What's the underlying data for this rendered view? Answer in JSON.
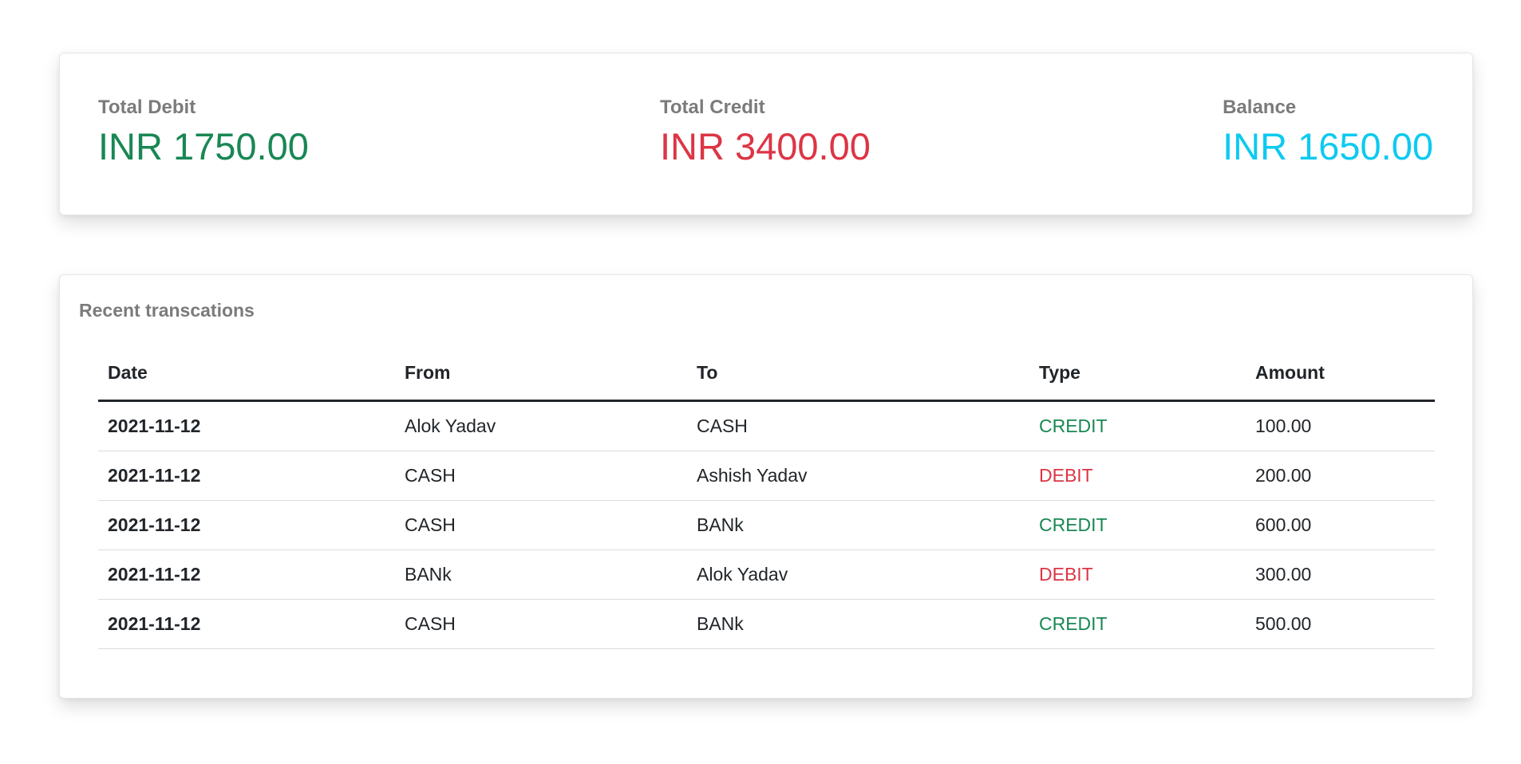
{
  "summary": {
    "total_debit": {
      "label": "Total Debit",
      "value": "INR 1750.00",
      "color": "#198754"
    },
    "total_credit": {
      "label": "Total Credit",
      "value": "INR 3400.00",
      "color": "#dc3545"
    },
    "balance": {
      "label": "Balance",
      "value": "INR 1650.00",
      "color": "#0dcaf0"
    }
  },
  "transactions": {
    "title": "Recent transcations",
    "columns": [
      "Date",
      "From",
      "To",
      "Type",
      "Amount"
    ],
    "rows": [
      {
        "date": "2021-11-12",
        "from": "Alok Yadav",
        "to": "CASH",
        "type": "CREDIT",
        "amount": "100.00"
      },
      {
        "date": "2021-11-12",
        "from": "CASH",
        "to": "Ashish Yadav",
        "type": "DEBIT",
        "amount": "200.00"
      },
      {
        "date": "2021-11-12",
        "from": "CASH",
        "to": "BANk",
        "type": "CREDIT",
        "amount": "600.00"
      },
      {
        "date": "2021-11-12",
        "from": "BANk",
        "to": "Alok Yadav",
        "type": "DEBIT",
        "amount": "300.00"
      },
      {
        "date": "2021-11-12",
        "from": "CASH",
        "to": "BANk",
        "type": "CREDIT",
        "amount": "500.00"
      }
    ],
    "type_colors": {
      "CREDIT": "#198754",
      "DEBIT": "#dc3545"
    }
  }
}
